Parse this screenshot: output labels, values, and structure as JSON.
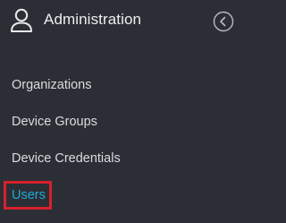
{
  "header": {
    "title": "Administration",
    "icon": "user-admin-icon",
    "collapse_icon": "chevron-left-icon"
  },
  "nav": {
    "items": [
      {
        "label": "Organizations"
      },
      {
        "label": "Device Groups"
      },
      {
        "label": "Device Credentials"
      },
      {
        "label": "Users",
        "active": true
      }
    ]
  },
  "colors": {
    "background": "#2b2f35",
    "text": "#d9dce0",
    "active_text": "#1fa8d8",
    "highlight_border": "#d7212b"
  }
}
